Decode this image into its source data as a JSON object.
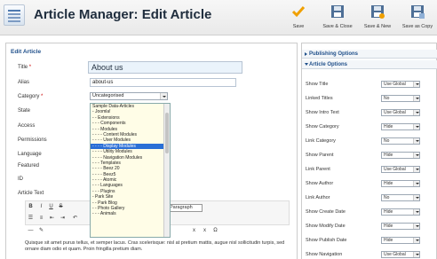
{
  "header": {
    "title": "Article Manager: Edit Article",
    "toolbar": [
      {
        "label": "Save",
        "icon": "check-icon"
      },
      {
        "label": "Save & Close",
        "icon": "save-close-icon"
      },
      {
        "label": "Save & New",
        "icon": "save-new-icon"
      },
      {
        "label": "Save as Copy",
        "icon": "save-copy-icon"
      }
    ]
  },
  "form": {
    "legend": "Edit Article",
    "labels": {
      "title": "Title",
      "alias": "Alias",
      "category": "Category",
      "state": "State",
      "access": "Access",
      "permissions": "Permissions",
      "language": "Language",
      "featured": "Featured",
      "id": "ID",
      "article_text": "Article Text"
    },
    "title_value": "About us",
    "alias_value": "about-us",
    "category_value": "Uncategorised"
  },
  "category_dropdown": {
    "items": [
      "Sample Data-Articles",
      "- Joomla!",
      "- - Extensions",
      "- - - Components",
      "- - - Modules",
      "- - - - Content Modules",
      "- - - - User Modules",
      "- - - - Display Modules",
      "- - - - Utility Modules",
      "- - - - Navigation Modules",
      "- - - Templates",
      "- - - - Beez 20",
      "- - - - Beez5",
      "- - - - Atomic",
      "- - - Languages",
      "- - - Plugins",
      "- Park Site",
      "- - Park Blog",
      "- - Photo Gallery",
      "- - - Animals"
    ],
    "selected": "- - - - Display Modules"
  },
  "editor": {
    "format_value": "Paragraph",
    "text": "Quisque sit amet purus tellus, et semper lacus. Cras scelerisque: nisl at pretium mattis, augue nisl sollicitudin turpis, sed ornare diam odio et quam. Proin fringilla pretium diam."
  },
  "side": {
    "publishing_options": "Publishing Options",
    "article_options": "Article Options",
    "options": [
      {
        "label": "Show Title",
        "value": "Use Global"
      },
      {
        "label": "Linked Titles",
        "value": "No"
      },
      {
        "label": "Show Intro Text",
        "value": "Use Global"
      },
      {
        "label": "Show Category",
        "value": "Hide"
      },
      {
        "label": "Link Category",
        "value": "No"
      },
      {
        "label": "Show Parent",
        "value": "Hide"
      },
      {
        "label": "Link Parent",
        "value": "Use Global"
      },
      {
        "label": "Show Author",
        "value": "Hide"
      },
      {
        "label": "Link Author",
        "value": "No"
      },
      {
        "label": "Show Create Date",
        "value": "Hide"
      },
      {
        "label": "Show Modify Date",
        "value": "Hide"
      },
      {
        "label": "Show Publish Date",
        "value": "Hide"
      },
      {
        "label": "Show Navigation",
        "value": "Use Global"
      }
    ]
  }
}
